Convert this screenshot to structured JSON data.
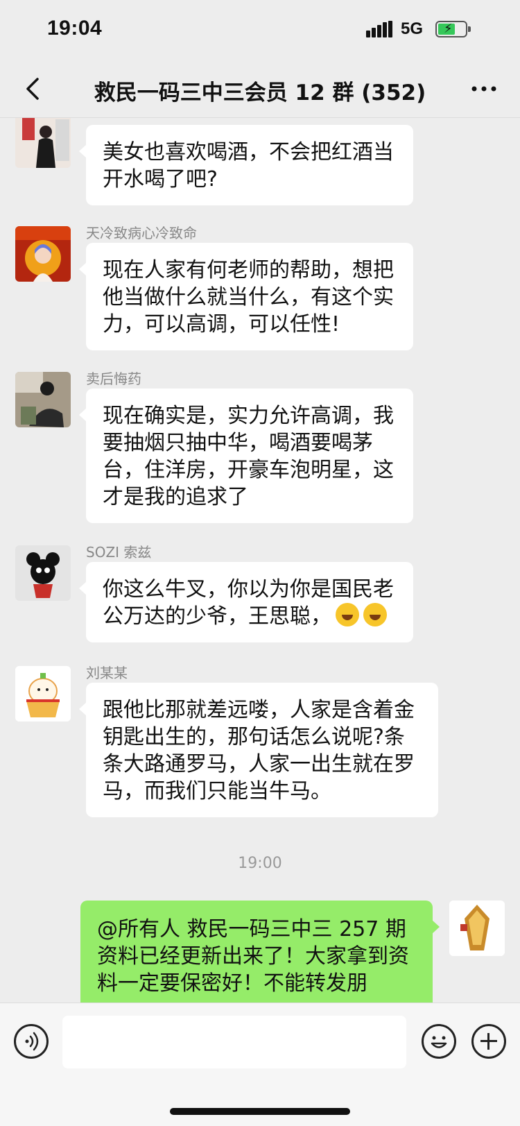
{
  "status_bar": {
    "time": "19:04",
    "network": "5G",
    "battery_color": "#35c759"
  },
  "nav": {
    "title": "救民一码三中三会员 12 群 (352)",
    "back_icon": "chevron-left-icon",
    "more_icon": "more-dots-icon"
  },
  "messages": [
    {
      "sender": "",
      "text": "美女也喜欢喝酒，不会把红酒当开水喝了吧?"
    },
    {
      "sender": "天冷致病心冷致命",
      "text": "现在人家有何老师的帮助，想把他当做什么就当什么，有这个实力，可以高调，可以任性!"
    },
    {
      "sender": "卖后悔药",
      "text": "现在确实是，实力允许高调，我要抽烟只抽中华，喝酒要喝茅台，住洋房，开豪车泡明星，这才是我的追求了"
    },
    {
      "sender": "SOZI 索兹",
      "text": "你这么牛叉，你以为你是国民老公万达的少爷，王思聪，"
    },
    {
      "sender": "刘某某",
      "text": "跟他比那就差远喽，人家是含着金钥匙出生的，那句话怎么说呢?条条大路通罗马，人家一出生就在罗马，而我们只能当牛马。"
    }
  ],
  "timestamp": "19:00",
  "outgoing": {
    "text": "@所有人  救民一码三中三 257 期资料已经更新出来了！大家拿到资料一定要保密好！不能转发朋"
  },
  "input_bar": {
    "voice_icon": "voice-icon",
    "emoji_icon": "emoji-icon",
    "plus_icon": "plus-icon",
    "placeholder": ""
  },
  "colors": {
    "background": "#ededed",
    "incoming_bubble": "#ffffff",
    "outgoing_bubble": "#95ec69"
  }
}
